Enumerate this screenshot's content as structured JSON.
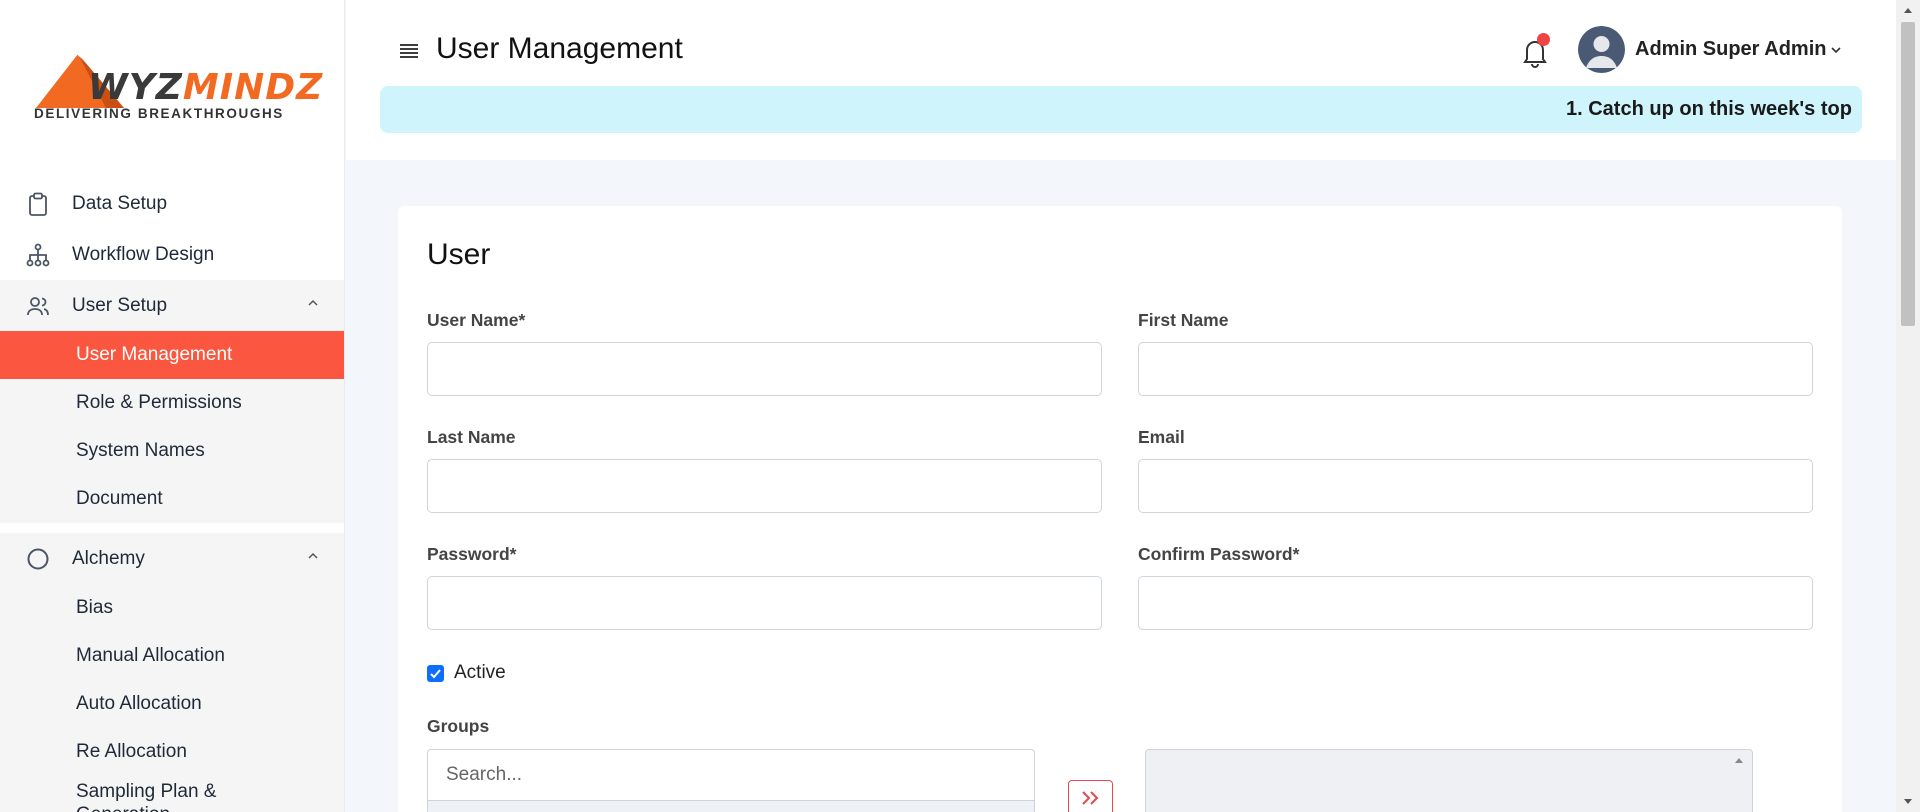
{
  "logo": {
    "word_part1": "WYZ",
    "word_part2": "MINDZ",
    "tagline": "DELIVERING BREAKTHROUGHS",
    "brand_color": "#f26a21"
  },
  "sidebar": {
    "items": [
      {
        "label": "Data Setup",
        "icon": "clipboard-icon"
      },
      {
        "label": "Workflow Design",
        "icon": "workflow-tree-icon"
      }
    ],
    "user_setup": {
      "label": "User Setup",
      "icon": "users-icon",
      "children": [
        "User Management",
        "Role & Permissions",
        "System Names",
        "Document"
      ],
      "active": "User Management"
    },
    "alchemy": {
      "label": "Alchemy",
      "icon": "circle-icon",
      "children": [
        "Bias",
        "Manual Allocation",
        "Auto Allocation",
        "Re Allocation",
        "Sampling Plan & Generation"
      ]
    },
    "active_color": "#fb5740"
  },
  "header": {
    "title": "User Management",
    "user_name": "Admin Super Admin",
    "ticker": "1. Catch up on this week's top"
  },
  "form": {
    "title": "User",
    "fields": {
      "user_name": {
        "label": "User Name*",
        "value": ""
      },
      "first_name": {
        "label": "First Name",
        "value": ""
      },
      "last_name": {
        "label": "Last Name",
        "value": ""
      },
      "email": {
        "label": "Email",
        "value": ""
      },
      "password": {
        "label": "Password*",
        "value": ""
      },
      "confirm_password": {
        "label": "Confirm Password*",
        "value": ""
      }
    },
    "active_label": "Active",
    "active_checked": true,
    "groups_label": "Groups",
    "groups_search_placeholder": "Search..."
  }
}
